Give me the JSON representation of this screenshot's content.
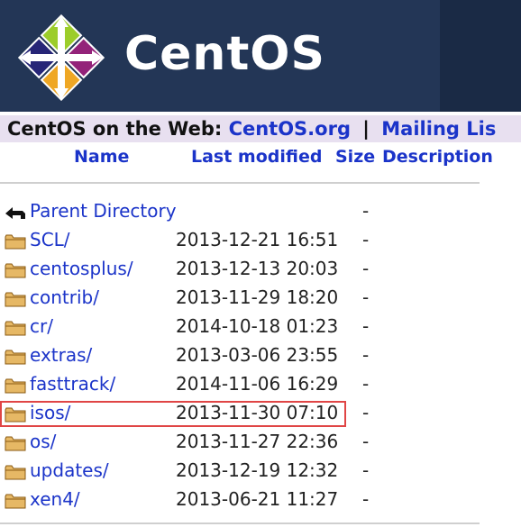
{
  "banner": {
    "logo_text": "CentOS"
  },
  "webbar": {
    "label": "CentOS on the Web:",
    "link1": "CentOS.org",
    "separator": "|",
    "link2": "Mailing Lis"
  },
  "columns": {
    "name": "Name",
    "modified": "Last modified",
    "size": "Size",
    "description": "Description"
  },
  "parent": {
    "name": "Parent Directory",
    "size": "-"
  },
  "entries": [
    {
      "name": "SCL/",
      "modified": "2013-12-21 16:51",
      "size": "-"
    },
    {
      "name": "centosplus/",
      "modified": "2013-12-13 20:03",
      "size": "-"
    },
    {
      "name": "contrib/",
      "modified": "2013-11-29 18:20",
      "size": "-"
    },
    {
      "name": "cr/",
      "modified": "2014-10-18 01:23",
      "size": "-"
    },
    {
      "name": "extras/",
      "modified": "2013-03-06 23:55",
      "size": "-"
    },
    {
      "name": "fasttrack/",
      "modified": "2014-11-06 16:29",
      "size": "-"
    },
    {
      "name": "isos/",
      "modified": "2013-11-30 07:10",
      "size": "-"
    },
    {
      "name": "os/",
      "modified": "2013-11-27 22:36",
      "size": "-"
    },
    {
      "name": "updates/",
      "modified": "2013-12-19 12:32",
      "size": "-"
    },
    {
      "name": "xen4/",
      "modified": "2013-06-21 11:27",
      "size": "-"
    }
  ],
  "icons": {
    "folder": "folder-icon",
    "back": "back-arrow-icon"
  },
  "colors": {
    "banner": "#233656",
    "link": "#1b34c9",
    "webbar": "#e8e0f0",
    "highlight": "#e04545"
  }
}
